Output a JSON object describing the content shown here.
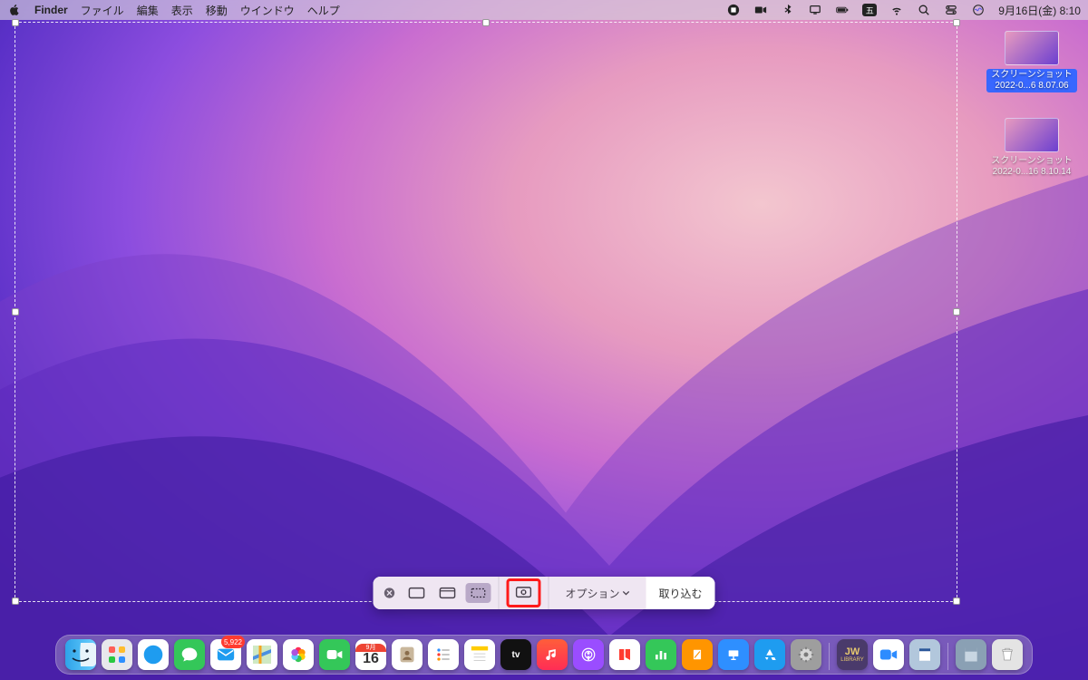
{
  "menubar": {
    "app_name": "Finder",
    "items": [
      "ファイル",
      "編集",
      "表示",
      "移動",
      "ウインドウ",
      "ヘルプ"
    ],
    "clock": "9月16日(金) 8:10"
  },
  "desktop_files": [
    {
      "name": "スクリーンショット 2022-0...6 8.07.06",
      "selected": true
    },
    {
      "name": "スクリーンショット 2022-0...16 8.10.14",
      "selected": false
    }
  ],
  "screenshot_toolbar": {
    "options_label": "オプション",
    "capture_label": "取り込む",
    "buttons": {
      "close": "close",
      "capture_screen": "capture-entire-screen",
      "capture_window": "capture-window",
      "capture_selection": "capture-selection",
      "record_screen": "record-screen",
      "record_selection": "record-selection"
    }
  },
  "dock": {
    "calendar": {
      "month": "9月",
      "day": "16"
    },
    "mail_badge": "5,922",
    "apps": [
      "finder",
      "launchpad",
      "safari",
      "messages",
      "mail",
      "maps",
      "photos",
      "facetime",
      "calendar",
      "contacts",
      "reminders",
      "notes",
      "tv",
      "music",
      "podcasts",
      "news",
      "numbers",
      "keynote",
      "pages",
      "appstore",
      "settings"
    ],
    "right": [
      "jwlibrary",
      "zoom",
      "word",
      "folder",
      "trash"
    ]
  }
}
